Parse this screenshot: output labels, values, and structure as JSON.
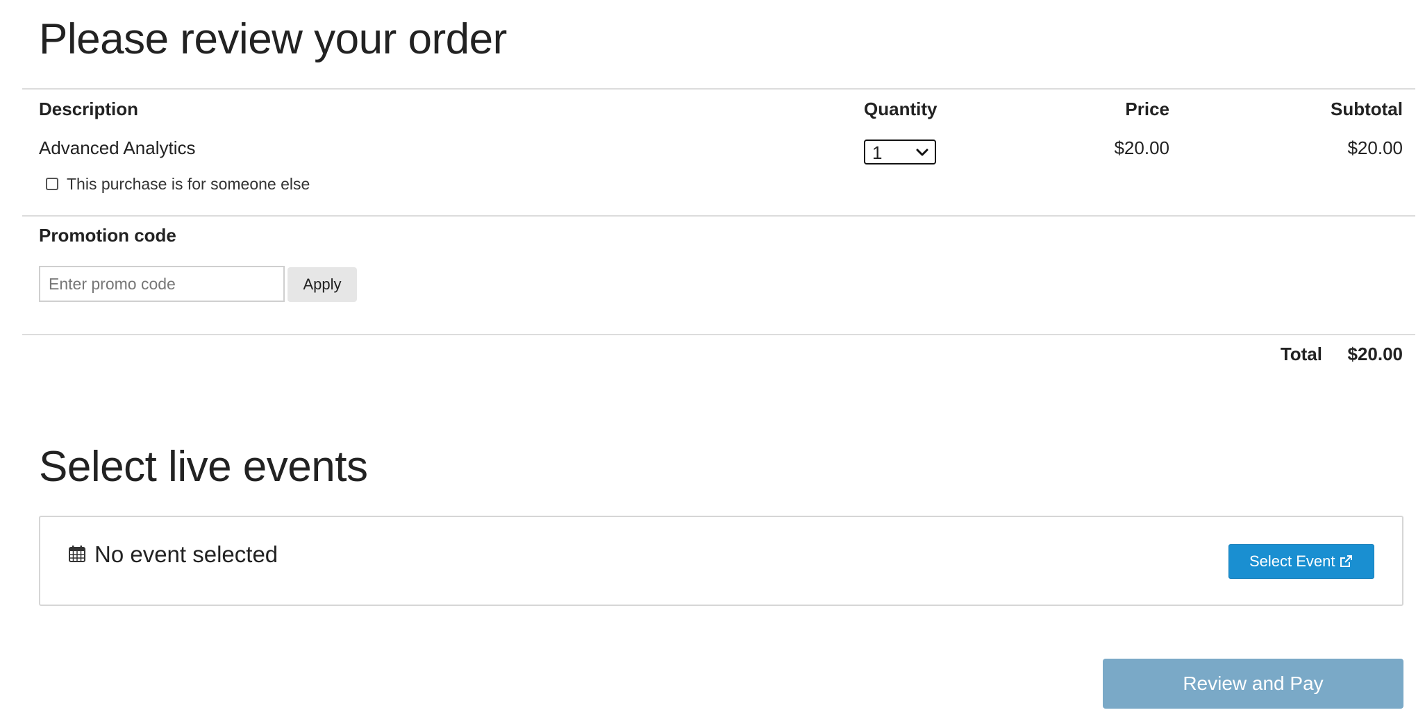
{
  "order": {
    "title": "Please review your order",
    "columns": {
      "description": "Description",
      "quantity": "Quantity",
      "price": "Price",
      "subtotal": "Subtotal"
    },
    "items": [
      {
        "description": "Advanced Analytics",
        "quantity": "1",
        "price": "$20.00",
        "subtotal": "$20.00"
      }
    ],
    "gift_checkbox_label": "This purchase is for someone else",
    "gift_checkbox_checked": false,
    "promo": {
      "label": "Promotion code",
      "placeholder": "Enter promo code",
      "value": "",
      "apply_label": "Apply"
    },
    "total_label": "Total",
    "total_value": "$20.00"
  },
  "events": {
    "title": "Select live events",
    "empty_icon": "calendar-icon",
    "empty_text": "No event selected",
    "select_button_label": "Select Event",
    "select_button_icon": "external-link-icon",
    "select_button_color": "#1a8fd1"
  },
  "footer": {
    "review_button_label": "Review and Pay",
    "review_button_color": "#7aa9c7"
  }
}
